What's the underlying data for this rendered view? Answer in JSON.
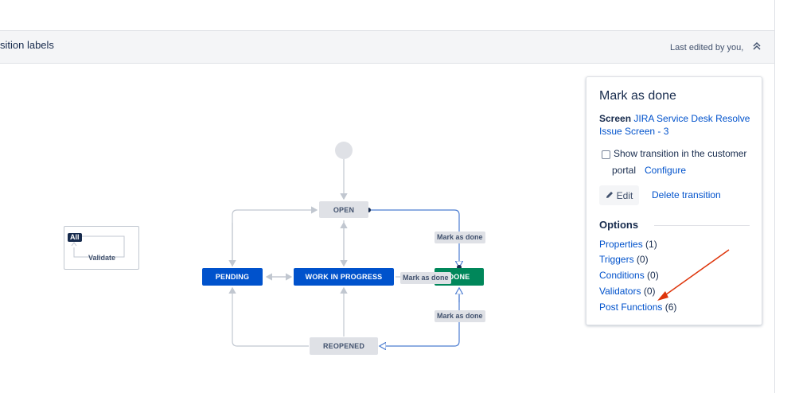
{
  "toolbar": {
    "title": "sition labels",
    "last_edited": "Last edited by you,",
    "collapse_icon": "double-chevron-up-icon"
  },
  "diagram": {
    "nodes": {
      "open": "OPEN",
      "pending": "PENDING",
      "in_progress": "WORK IN PROGRESS",
      "done": "DONE",
      "reopened": "REOPENED"
    },
    "transition_labels": [
      "Mark as done",
      "Mark as done",
      "Mark as done"
    ],
    "legend": {
      "badge": "All",
      "label": "Validate"
    }
  },
  "panel": {
    "title": "Mark as done",
    "screen_label": "Screen",
    "screen_link": "JIRA Service Desk Resolve Issue Screen - 3",
    "checkbox_label_line1": "Show transition in the customer",
    "checkbox_label_line2": "portal",
    "configure_link": "Configure",
    "edit_button": "Edit",
    "edit_icon": "pencil-icon",
    "delete_link": "Delete transition",
    "options_title": "Options",
    "options": [
      {
        "label": "Properties",
        "count": "(1)"
      },
      {
        "label": "Triggers",
        "count": "(0)"
      },
      {
        "label": "Conditions",
        "count": "(0)"
      },
      {
        "label": "Validators",
        "count": "(0)"
      },
      {
        "label": "Post Functions",
        "count": "(6)"
      }
    ]
  },
  "colors": {
    "accent_blue": "#0052cc",
    "done_green": "#00875a",
    "node_grey": "#dfe1e6",
    "annotation_red": "#de350b"
  }
}
